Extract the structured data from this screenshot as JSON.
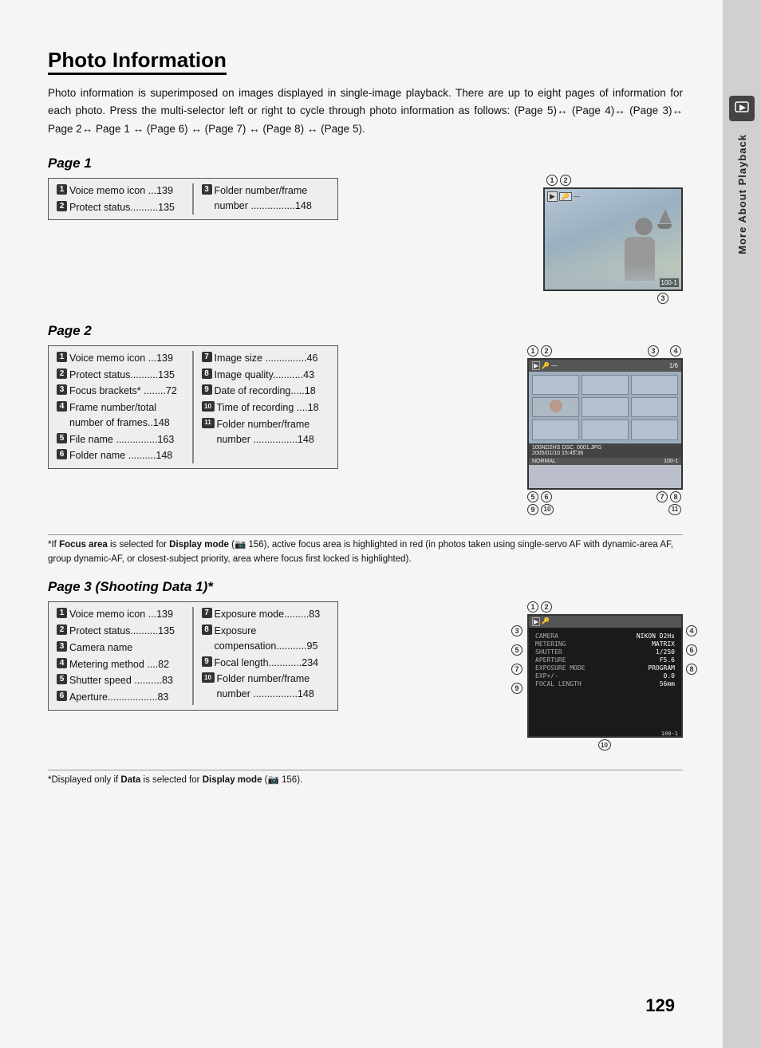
{
  "page": {
    "number": "129",
    "title": "Photo Information",
    "sidebar_label": "More About Playback"
  },
  "intro": {
    "text": "Photo information is superimposed on images displayed in single-image playback.  There are up to eight pages of information for each photo.  Press the multi-selector left or right to cycle through photo information as follows: (Page 5)↔ (Page 4)↔ (Page 3)↔ Page 2↔ Page 1 ↔ (Page 6) ↔ (Page 7) ↔ (Page 8) ↔ (Page 5)."
  },
  "page1": {
    "title": "Page 1",
    "col1": [
      {
        "num": "1",
        "text": "Voice memo icon ...139"
      },
      {
        "num": "2",
        "text": "Protect status..........135"
      }
    ],
    "col2": [
      {
        "num": "3",
        "text": "Folder number/frame number ................148"
      }
    ]
  },
  "page2": {
    "title": "Page 2",
    "col1": [
      {
        "num": "1",
        "text": "Voice memo icon ...139"
      },
      {
        "num": "2",
        "text": "Protect status..........135"
      },
      {
        "num": "3",
        "text": "Focus brackets* ........72"
      },
      {
        "num": "4",
        "text": "Frame number/total number of frames..148"
      },
      {
        "num": "5",
        "text": "File name ...............163"
      },
      {
        "num": "6",
        "text": "Folder name ..........148"
      }
    ],
    "col2": [
      {
        "num": "7",
        "text": "Image size ...............46"
      },
      {
        "num": "8",
        "text": "Image quality...........43"
      },
      {
        "num": "9",
        "text": "Date of recording.....18"
      },
      {
        "num": "10",
        "text": "Time of recording ....18"
      },
      {
        "num": "11",
        "text": "Folder number/frame number ................148"
      }
    ],
    "footnote": "*If Focus area is selected for Display mode (  156), active focus area is highlighted in red (in photos taken using single-servo AF with dynamic-area AF, group dynamic-AF, or closest-subject priority, area where focus first locked is highlighted)."
  },
  "page3": {
    "title": "Page 3 (Shooting Data 1)*",
    "col1": [
      {
        "num": "1",
        "text": "Voice memo icon ...139"
      },
      {
        "num": "2",
        "text": "Protect status..........135"
      },
      {
        "num": "3",
        "text": "Camera name"
      },
      {
        "num": "4",
        "text": "Metering method ....82"
      },
      {
        "num": "5",
        "text": "Shutter speed ..........83"
      },
      {
        "num": "6",
        "text": "Aperture..................83"
      }
    ],
    "col2": [
      {
        "num": "7",
        "text": "Exposure mode.........83"
      },
      {
        "num": "8",
        "text": "Exposure compensation...........95"
      },
      {
        "num": "9",
        "text": "Focal length............234"
      },
      {
        "num": "10",
        "text": "Folder number/frame number ................148"
      }
    ],
    "footnote": "*Displayed only if Data is selected for Display mode (  156)."
  },
  "diagram_page3_data": [
    {
      "label": "CAMERA",
      "value": "NIKON D2Hs"
    },
    {
      "label": "METERING",
      "value": "MATRIX"
    },
    {
      "label": "SHUTTER",
      "value": "1/250"
    },
    {
      "label": "APERTURE",
      "value": "F5.6"
    },
    {
      "label": "EXPOSURE MODE",
      "value": "PROGRAM"
    },
    {
      "label": "EXP+/-",
      "value": "0.0"
    },
    {
      "label": "FOCAL LENGTH",
      "value": "56mm"
    }
  ]
}
